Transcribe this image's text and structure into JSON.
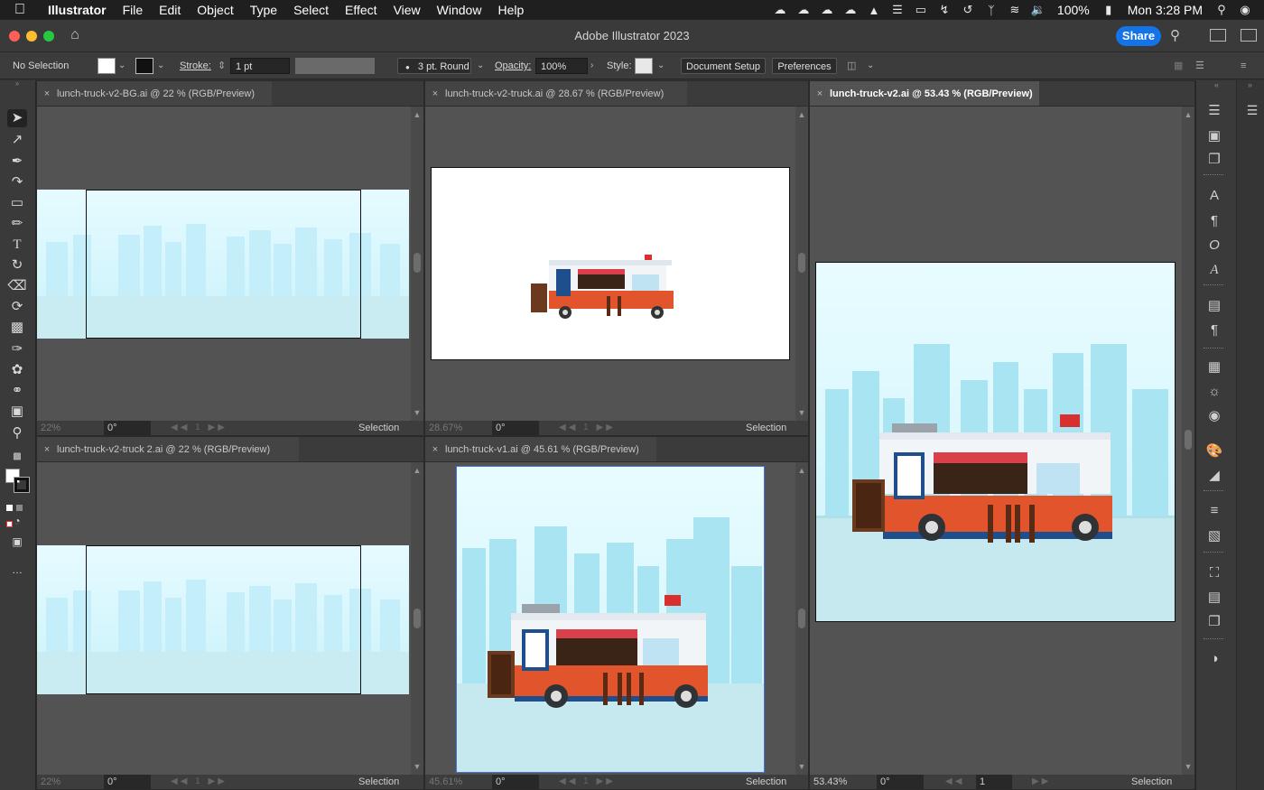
{
  "menubar": {
    "app_name": "Illustrator",
    "items": [
      "File",
      "Edit",
      "Object",
      "Type",
      "Select",
      "Effect",
      "View",
      "Window",
      "Help"
    ],
    "battery": "100%",
    "datetime": "Mon 3:28 PM"
  },
  "window": {
    "title": "Adobe Illustrator 2023",
    "share_label": "Share"
  },
  "control_bar": {
    "selection_state": "No Selection",
    "stroke_label": "Stroke:",
    "stroke_value": "1 pt",
    "brush_value": "3 pt. Round",
    "opacity_label": "Opacity:",
    "opacity_value": "100%",
    "style_label": "Style:",
    "document_setup_label": "Document Setup",
    "preferences_label": "Preferences"
  },
  "documents": [
    {
      "tab": "lunch-truck-v2-BG.ai @ 22 % (RGB/Preview)",
      "zoom": "22%",
      "rotation": "0°",
      "page": "1",
      "tool": "Selection"
    },
    {
      "tab": "lunch-truck-v2-truck.ai @ 28.67 % (RGB/Preview)",
      "zoom": "28.67%",
      "rotation": "0°",
      "page": "1",
      "tool": "Selection"
    },
    {
      "tab": "lunch-truck-v2.ai @ 53.43 % (RGB/Preview)",
      "zoom": "53.43%",
      "rotation": "0°",
      "page": "1",
      "tool": "Selection"
    },
    {
      "tab": "lunch-truck-v2-truck 2.ai @ 22 % (RGB/Preview)",
      "zoom": "22%",
      "rotation": "0°",
      "page": "1",
      "tool": "Selection"
    },
    {
      "tab": "lunch-truck-v1.ai @ 45.61 % (RGB/Preview)",
      "zoom": "45.61%",
      "rotation": "0°",
      "page": "1",
      "tool": "Selection"
    }
  ],
  "colors": {
    "accent": "#1473e6",
    "sky": "#e6fbff",
    "truck_red": "#e2542b",
    "truck_blue": "#1f4e8c"
  }
}
